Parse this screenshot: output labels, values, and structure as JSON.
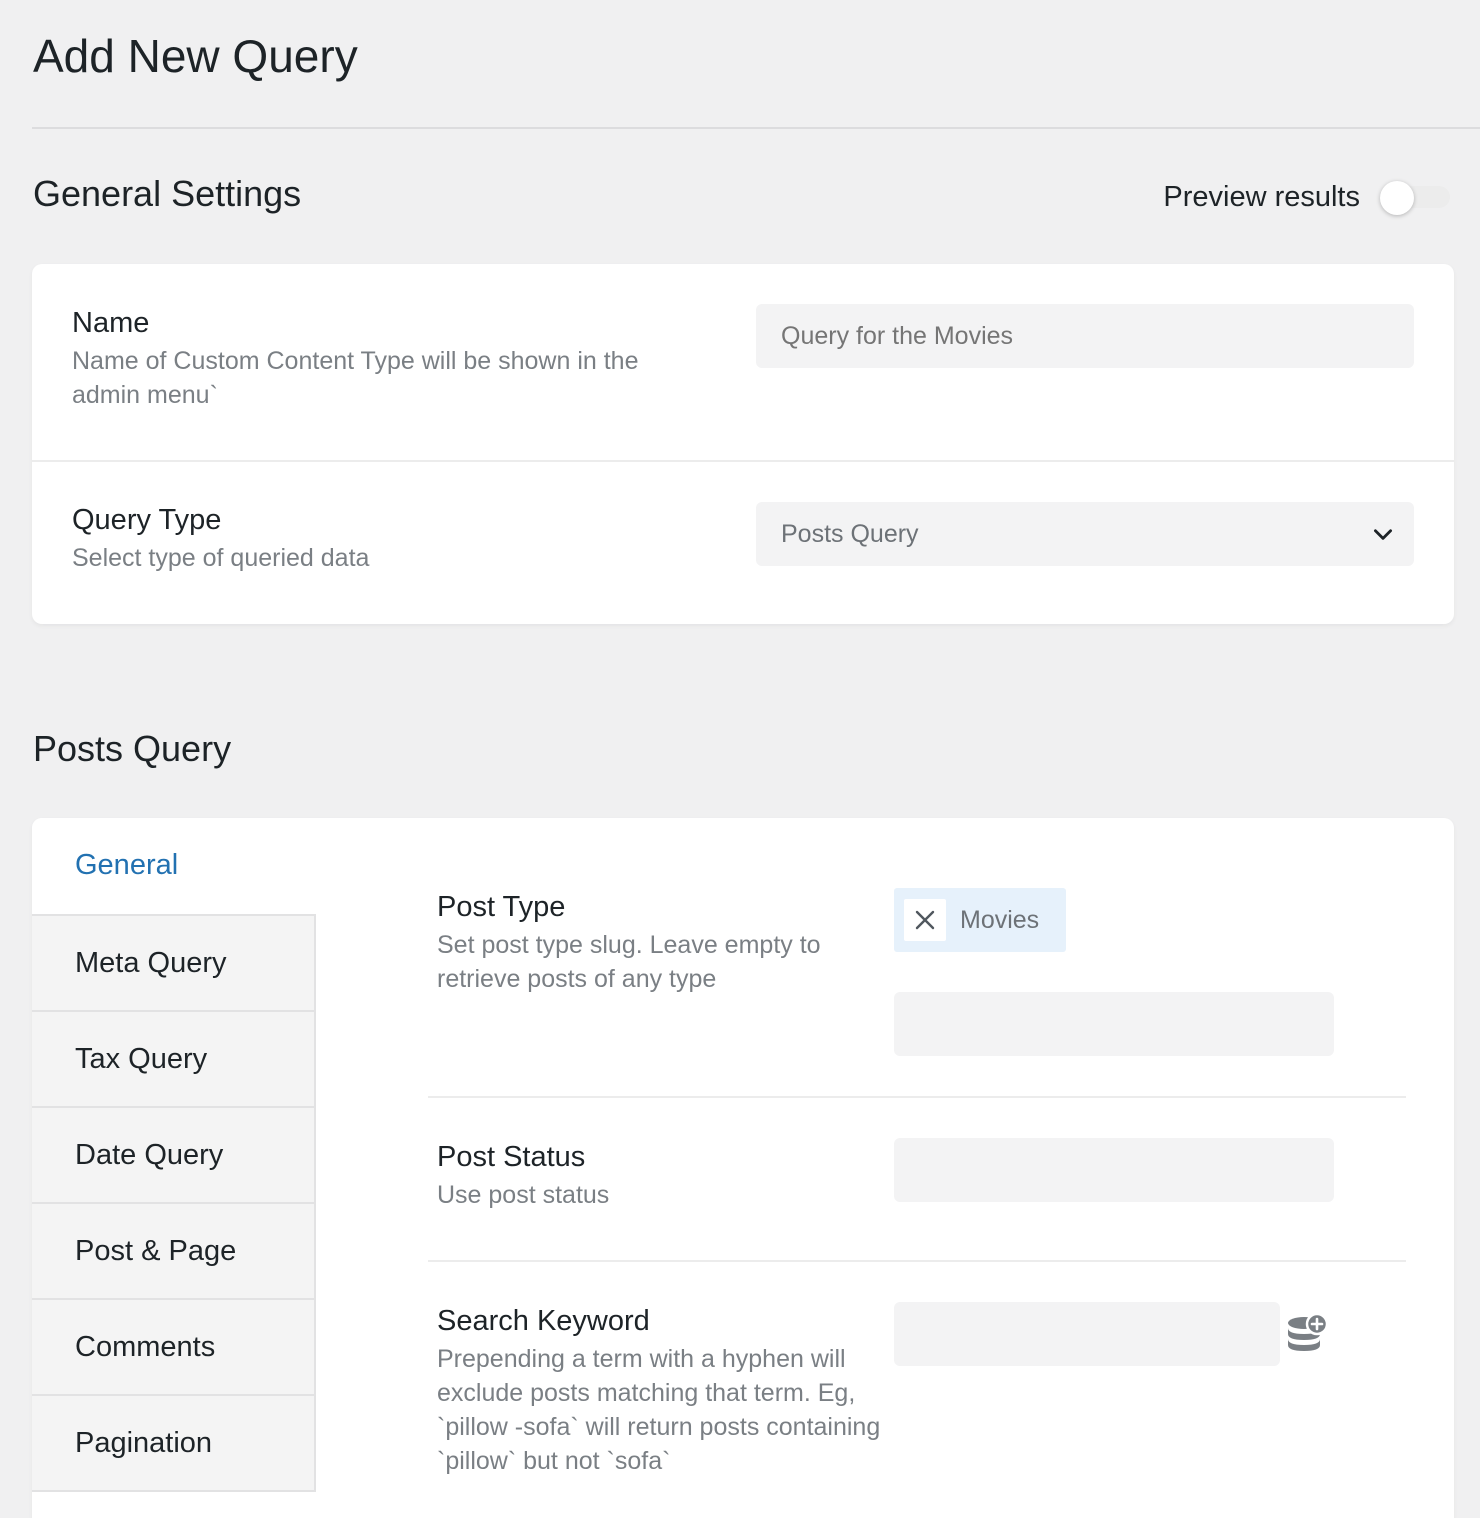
{
  "page": {
    "title": "Add New Query"
  },
  "general_settings": {
    "title": "General Settings",
    "preview_label": "Preview results",
    "preview_enabled": false,
    "fields": {
      "name": {
        "label": "Name",
        "description": "Name of Custom Content Type will be shown in the admin menu`",
        "placeholder": "Query for the Movies",
        "value": ""
      },
      "query_type": {
        "label": "Query Type",
        "description": "Select type of queried data",
        "value": "Posts Query"
      }
    }
  },
  "posts_query": {
    "title": "Posts Query",
    "tabs": [
      {
        "label": "General",
        "active": true
      },
      {
        "label": "Meta Query",
        "active": false
      },
      {
        "label": "Tax Query",
        "active": false
      },
      {
        "label": "Date Query",
        "active": false
      },
      {
        "label": "Post & Page",
        "active": false
      },
      {
        "label": "Comments",
        "active": false
      },
      {
        "label": "Pagination",
        "active": false
      }
    ],
    "fields": {
      "post_type": {
        "label": "Post Type",
        "description": "Set post type slug. Leave empty to retrieve posts of any type",
        "selected": [
          "Movies"
        ],
        "input_value": ""
      },
      "post_status": {
        "label": "Post Status",
        "description": "Use post status",
        "value": ""
      },
      "search_keyword": {
        "label": "Search Keyword",
        "description": "Prepending a term with a hyphen will exclude posts matching that term. Eg, `pillow -sofa` will return posts containing `pillow` but not `sofa`",
        "value": "",
        "dynamic_icon": "database-plus-icon"
      }
    }
  },
  "colors": {
    "accent": "#2271b1",
    "background": "#f0f0f1",
    "chip_background": "#e6f1fb"
  }
}
